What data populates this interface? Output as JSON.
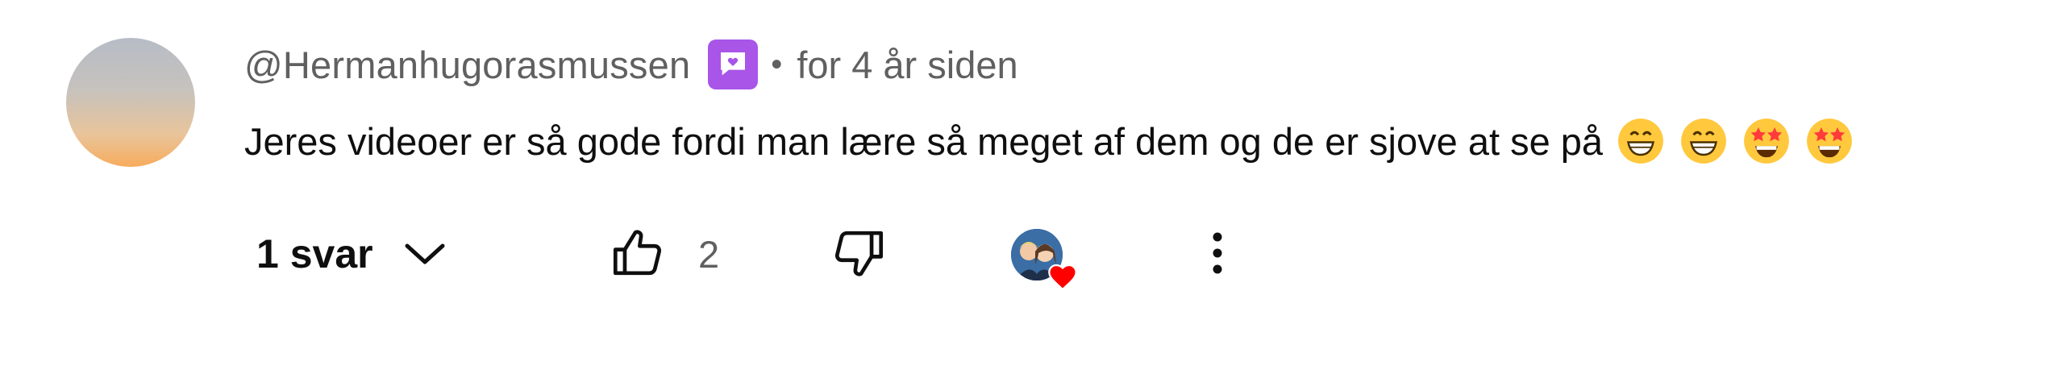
{
  "comment": {
    "author": "@Hermanhugorasmussen",
    "separator": "•",
    "timestamp": "for 4 år siden",
    "text": "Jeres videoer er så gode fordi man lære så meget af dem og de er sjove at se på",
    "emojis": [
      "grinning-face-with-smiling-eyes",
      "grinning-face-with-smiling-eyes",
      "star-struck",
      "star-struck"
    ]
  },
  "actions": {
    "replies_label": "1 svar",
    "like_count": "2"
  },
  "colors": {
    "member_badge": "#a855e8",
    "heart": "#ff0000",
    "secondary_text": "#606060",
    "primary_text": "#0f0f0f"
  },
  "icons": {
    "member_badge": "heart-speech-bubble-icon",
    "replies_toggle": "chevron-down-icon",
    "like": "thumbs-up-icon",
    "dislike": "thumbs-down-icon",
    "creator_heart": "heart-icon",
    "more": "more-vertical-icon"
  }
}
